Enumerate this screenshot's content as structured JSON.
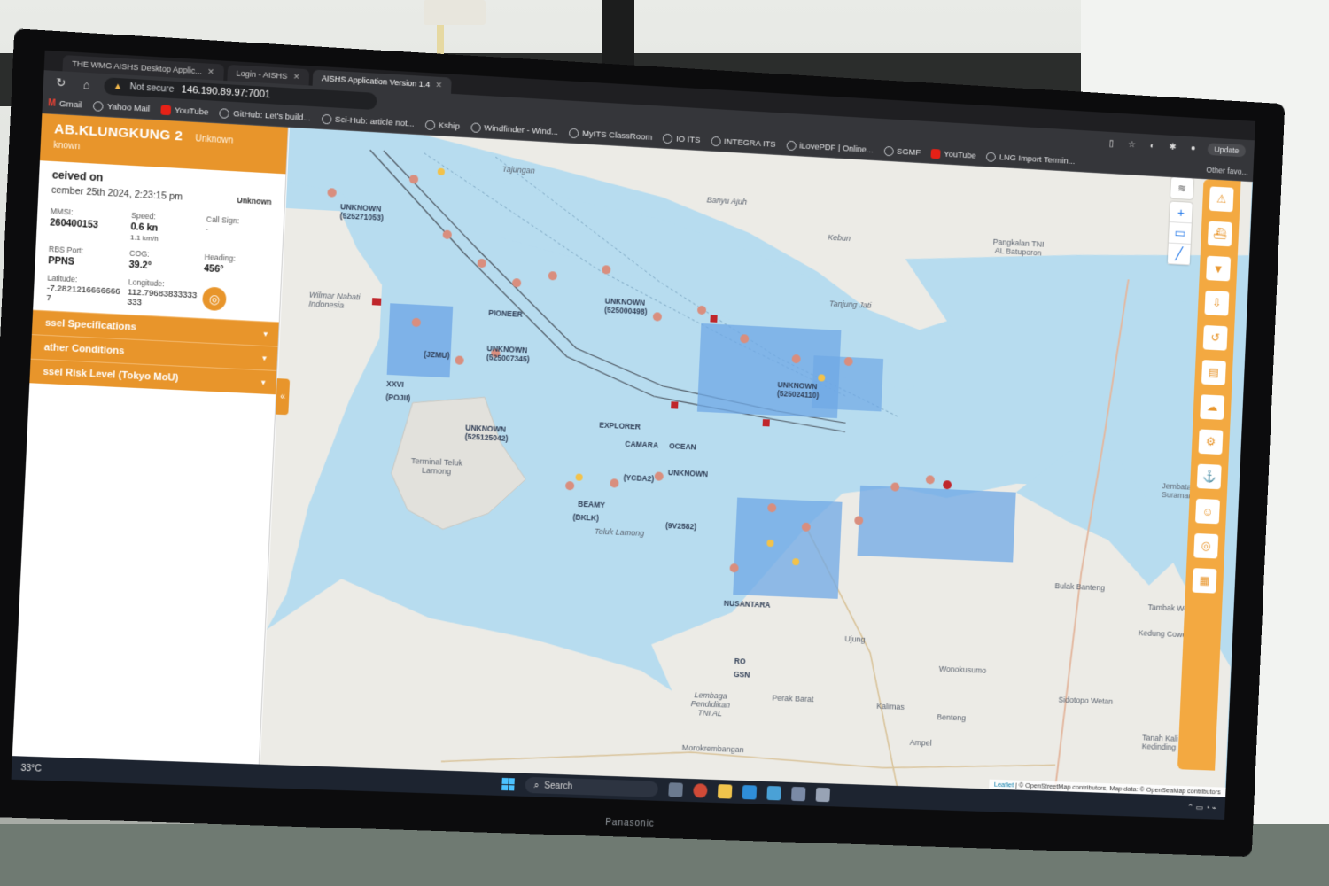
{
  "browser": {
    "tabs": [
      {
        "label": "THE WMG AISHS Desktop Applic...",
        "active": false
      },
      {
        "label": "Login - AISHS",
        "active": false
      },
      {
        "label": "AISHS Application Version 1.4",
        "active": true
      }
    ],
    "security": "Not secure",
    "url": "146.190.89.97:7001",
    "update_label": "Update",
    "bookmarks": [
      "Gmail",
      "Yahoo Mail",
      "YouTube",
      "GitHub: Let's build...",
      "Sci-Hub: article not...",
      "Kship",
      "Windfinder - Wind...",
      "MyITS ClassRoom",
      "IO ITS",
      "INTEGRA ITS",
      "iLovePDF | Online...",
      "SGMF",
      "YouTube",
      "LNG Import Termin..."
    ],
    "other_favorites": "Other favo..."
  },
  "vessel": {
    "name": "AB.KLUNGKUNG 2",
    "type_inline": "Unknown",
    "subtitle": "known",
    "received_label": "ceived on",
    "received_time": "cember 25th 2024, 2:23:15 pm",
    "received_status": "Unknown",
    "mmsi_label": "MMSI:",
    "mmsi": "260400153",
    "speed_label": "Speed:",
    "speed": "0.6 kn",
    "speed_kmh": "1.1 km/h",
    "callsign_label": "Call Sign:",
    "callsign": "-",
    "rbs_label": "RBS Port:",
    "rbs": "PPNS",
    "cog_label": "COG:",
    "cog": "39.2°",
    "heading_label": "Heading:",
    "heading": "456°",
    "lat_label": "Latitude:",
    "lat": "-7.28212166666667",
    "lon_label": "Longitude:",
    "lon": "112.79683833333333",
    "sections": [
      "ssel Specifications",
      "ather Conditions",
      "ssel Risk Level (Tokyo MoU)"
    ]
  },
  "map": {
    "places": [
      {
        "t": "Tajungan"
      },
      {
        "t": "Banyu Ajuh"
      },
      {
        "t": "Kebun"
      },
      {
        "t": "Pangkalan TNI AL Batuporon"
      },
      {
        "t": "Tanjung Jati"
      },
      {
        "t": "Wilmar Nabati Indonesia"
      },
      {
        "t": "Terminal Teluk Lamong"
      },
      {
        "t": "Teluk Lamong"
      },
      {
        "t": "Bulak Banteng"
      },
      {
        "t": "Tambak Wedi"
      },
      {
        "t": "Kedung Cowek"
      },
      {
        "t": "Wonokusumo"
      },
      {
        "t": "Sidotopo Wetan"
      },
      {
        "t": "Ujung"
      },
      {
        "t": "Perak Barat"
      },
      {
        "t": "Lembaga Pendidikan TNI AL"
      },
      {
        "t": "Morokrembangan"
      },
      {
        "t": "Ampel"
      },
      {
        "t": "Tanah Kali Kedinding"
      },
      {
        "t": "Jembatan Suramadu"
      },
      {
        "t": "Benteng"
      },
      {
        "t": "Kalimas"
      }
    ],
    "ships": [
      {
        "t": "UNKNOWN (525271053)"
      },
      {
        "t": "UNKNOWN (525000498)"
      },
      {
        "t": "UNKNOWN (525007345)"
      },
      {
        "t": "UNKNOWN (525125042)"
      },
      {
        "t": "PIONEER"
      },
      {
        "t": "EXPLORER"
      },
      {
        "t": "CAMARA"
      },
      {
        "t": "OCEAN"
      },
      {
        "t": "UNKNOWN"
      },
      {
        "t": "(YCDA2)"
      },
      {
        "t": "(POJII)"
      },
      {
        "t": "(BKLK)"
      },
      {
        "t": "(9V2582)"
      },
      {
        "t": "UNKNOWN (525024110)"
      },
      {
        "t": "NUSANTARA"
      },
      {
        "t": "(JZMU)"
      },
      {
        "t": "GSN"
      },
      {
        "t": "RO"
      },
      {
        "t": "BEAMY"
      },
      {
        "t": "XXVI"
      }
    ],
    "attribution_leaflet": "Leaflet",
    "attribution": "| © OpenStreetMap contributors, Map data: © OpenSeaMap contributors"
  },
  "taskbar": {
    "weather": "33°C",
    "search": "Search"
  },
  "monitor_brand": "Panasonic"
}
